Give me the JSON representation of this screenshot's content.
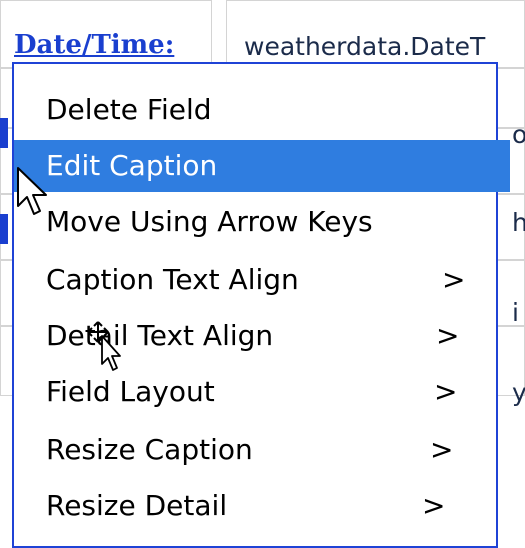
{
  "form": {
    "caption_top": "Date/Time:",
    "detail_top": "weatherdata.DateT",
    "peek_right_1": "o",
    "peek_right_2": "h",
    "peek_right_3": "i",
    "peek_right_4": "y"
  },
  "context_menu": {
    "items": [
      {
        "label": "Delete Field",
        "submenu": ""
      },
      {
        "label": "Edit Caption",
        "submenu": ""
      },
      {
        "label": "Move Using Arrow Keys",
        "submenu": ""
      },
      {
        "label": "Caption Text Align",
        "submenu": ">"
      },
      {
        "label": "Detail Text Align",
        "submenu": ">"
      },
      {
        "label": "Field Layout",
        "submenu": ">"
      },
      {
        "label": "Resize Caption",
        "submenu": ">"
      },
      {
        "label": "Resize Detail",
        "submenu": ">"
      }
    ],
    "selected_index": 1
  },
  "colors": {
    "menu_border": "#1f43d6",
    "selection": "#2f7de0",
    "caption_blue": "#1a3fcf"
  },
  "icons": [
    "arrow-pointer-icon",
    "move-cursor-icon"
  ]
}
